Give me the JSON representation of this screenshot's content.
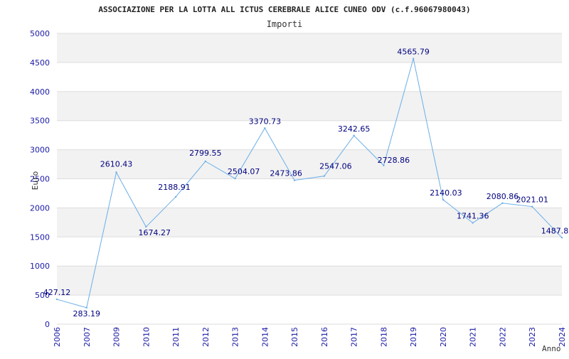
{
  "chart_data": {
    "type": "line",
    "title": "ASSOCIAZIONE PER LA LOTTA ALL ICTUS CEREBRALE ALICE CUNEO ODV (c.f.96067980043)",
    "subtitle": "Importi",
    "xlabel": "Anno",
    "ylabel": "Euro",
    "ylim": [
      0,
      5000
    ],
    "yticks": [
      0,
      500,
      1000,
      1500,
      2000,
      2500,
      3000,
      3500,
      4000,
      4500,
      5000
    ],
    "grid": true,
    "categories": [
      "2006",
      "2007",
      "2009",
      "2010",
      "2011",
      "2012",
      "2013",
      "2014",
      "2015",
      "2016",
      "2017",
      "2018",
      "2019",
      "2020",
      "2021",
      "2022",
      "2023",
      "2024"
    ],
    "values": [
      427.12,
      283.19,
      2610.43,
      1674.27,
      2188.91,
      2799.55,
      2504.07,
      3370.73,
      2473.86,
      2547.06,
      3242.65,
      2728.86,
      4565.79,
      2140.03,
      1741.36,
      2080.86,
      2021.01,
      1487.8
    ],
    "value_labels": [
      "427.12",
      "283.19",
      "2610.43",
      "1674.27",
      "2188.91",
      "2799.55",
      "2504.07",
      "3370.73",
      "2473.86",
      "2547.06",
      "3242.65",
      "2728.86",
      "4565.79",
      "2140.03",
      "1741.36",
      "2080.86",
      "2021.01",
      "1487.8"
    ],
    "colors": {
      "line": "#6aaee8",
      "band": "#f2f2f2",
      "grid": "#dddddd",
      "tick_text": "#1a1aa6",
      "label_text": "#000080"
    }
  }
}
